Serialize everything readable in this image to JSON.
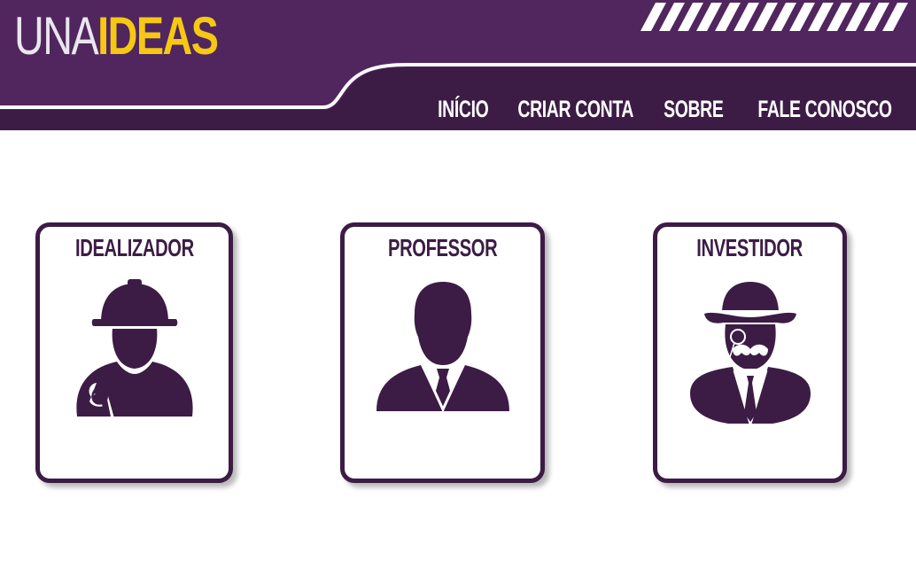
{
  "brand": {
    "logo_part1": "UNA",
    "logo_part2": "IDEAS"
  },
  "colors": {
    "primary_purple": "#51255e",
    "dark_purple": "#3c1c45",
    "accent_yellow": "#f5c813",
    "white": "#ffffff"
  },
  "nav": {
    "items": [
      {
        "label": "INÍCIO"
      },
      {
        "label": "CRIAR CONTA"
      },
      {
        "label": "SOBRE"
      },
      {
        "label": "FALE CONOSCO"
      }
    ]
  },
  "cards": [
    {
      "title": "IDEALIZADOR",
      "icon": "worker-icon"
    },
    {
      "title": "PROFESSOR",
      "icon": "businessman-icon"
    },
    {
      "title": "INVESTIDOR",
      "icon": "gentleman-icon"
    }
  ]
}
